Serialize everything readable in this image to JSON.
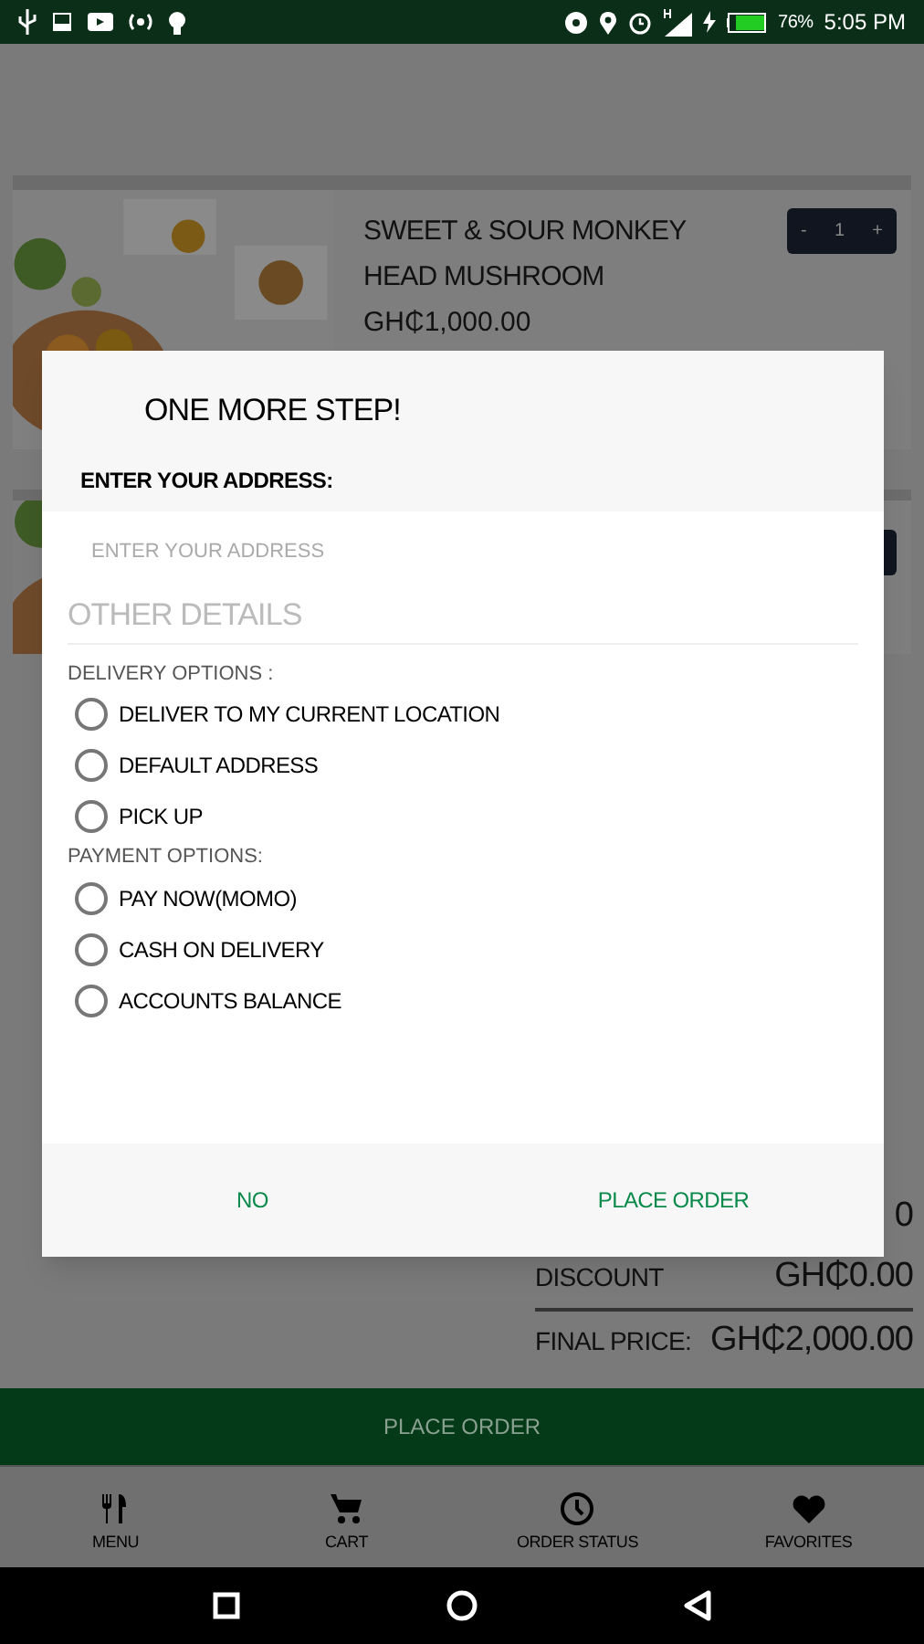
{
  "status_bar": {
    "battery": "76%",
    "time": "5:05 PM"
  },
  "cart_items": [
    {
      "kind": "full",
      "name": "SWEET & SOUR MONKEY HEAD MUSHROOM",
      "price": "GH₵1,000.00",
      "quantity": {
        "minus": "-",
        "value": "1",
        "plus": "+"
      }
    },
    {
      "kind": "covered"
    }
  ],
  "totals": [
    {
      "value": "0"
    },
    {
      "label": "DISCOUNT",
      "value": "GH₵0.00"
    },
    {
      "label": "FINAL PRICE:",
      "value": "GH₵2,000.00"
    }
  ],
  "place_order_button": "PLACE ORDER",
  "bottom_nav": [
    {
      "kind": "menu",
      "label": "MENU"
    },
    {
      "kind": "cart",
      "label": "CART"
    },
    {
      "kind": "clock",
      "label": "ORDER STATUS"
    },
    {
      "kind": "heart",
      "label": "FAVORITES"
    }
  ],
  "dialog": {
    "title": "ONE MORE STEP!",
    "address_label": "ENTER YOUR ADDRESS:",
    "address_field": {
      "placeholder": "ENTER YOUR ADDRESS"
    },
    "section_title": "OTHER DETAILS",
    "delivery_label": "DELIVERY OPTIONS :",
    "delivery_options": [
      {
        "label": "DELIVER TO MY CURRENT LOCATION",
        "selected": false
      },
      {
        "label": "DEFAULT ADDRESS",
        "selected": false
      },
      {
        "label": "PICK UP",
        "selected": false
      }
    ],
    "payment_label": "PAYMENT OPTIONS:",
    "payment_options": [
      {
        "label": "PAY NOW(MOMO)",
        "selected": false
      },
      {
        "label": "CASH ON DELIVERY",
        "selected": false
      },
      {
        "label": "ACCOUNTS BALANCE",
        "selected": false
      }
    ],
    "buttons": [
      "NO",
      "PLACE ORDER"
    ]
  }
}
